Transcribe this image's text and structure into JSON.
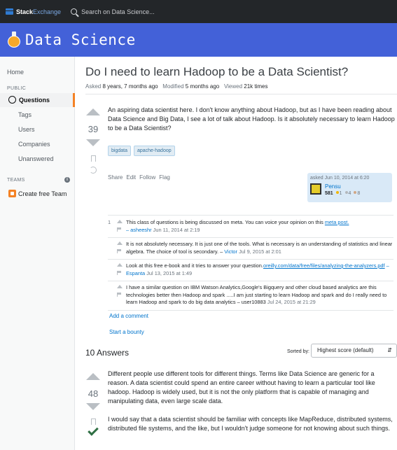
{
  "topbar": {
    "brand_a": "Stack",
    "brand_b": "Exchange",
    "search_placeholder": "Search on Data Science..."
  },
  "site": {
    "name": "Data Science"
  },
  "nav": {
    "home": "Home",
    "public_heading": "PUBLIC",
    "questions": "Questions",
    "tags": "Tags",
    "users": "Users",
    "companies": "Companies",
    "unanswered": "Unanswered",
    "teams_heading": "TEAMS",
    "create_team": "Create free Team"
  },
  "question": {
    "title": "Do I need to learn Hadoop to be a Data Scientist?",
    "asked_label": "Asked",
    "asked_value": "8 years, 7 months ago",
    "modified_label": "Modified",
    "modified_value": "5 months ago",
    "viewed_label": "Viewed",
    "viewed_value": "21k times",
    "score": "39",
    "body": "An aspiring data scientist here. I don't know anything about Hadoop, but as I have been reading about Data Science and Big Data, I see a lot of talk about Hadoop. Is it absolutely necessary to learn Hadoop to be a Data Scientist?",
    "tags": [
      "bigdata",
      "apache-hadoop"
    ],
    "actions": [
      "Share",
      "Edit",
      "Follow",
      "Flag"
    ],
    "owner": {
      "asked": "asked Jun 10, 2014 at 6:20",
      "name": "Pensu",
      "rep": "581",
      "gold": "1",
      "silver": "4",
      "bronze": "8"
    }
  },
  "comments": [
    {
      "num": "1",
      "text": "This class of questions is being discussed on meta. You can voice your opinion on this ",
      "link": "meta post.",
      "user": "– asheeshr",
      "date": "Jun 11, 2014 at 2:19"
    },
    {
      "num": "",
      "text": "It is not absolutely necessary. It is just one of the tools. What is necessary is an understanding of statistics and linear algebra. The choice of tool is secondary. – ",
      "link": "",
      "user": "Victor",
      "date": "Jul 9, 2015 at 2:01"
    },
    {
      "num": "",
      "text": "Look at this free e-book and it tries to answer your question.",
      "link": "oreilly.com/data/free/files/analyzing-the-analyzers.pdf",
      "user": " – Espanta",
      "date": "Jul 13, 2015 at 1:49"
    },
    {
      "num": "",
      "text": "I have a similar question on IBM Watson Analytics,Google's Bigquery and other cloud based analytics are this technologies better then Hadoop and spark .....I am just starting to learn Hadoop and spark and do I really need to learn Hadoop and spark to do big data analytics – user10883",
      "link": "",
      "user": "",
      "date": "Jul 24, 2015 at 21:29"
    }
  ],
  "add_comment": "Add a comment",
  "start_bounty": "Start a bounty",
  "answers": {
    "heading": "10 Answers",
    "sort_label": "Sorted by:",
    "sort_value": "Highest score (default)",
    "first": {
      "score": "48",
      "p1": "Different people use different tools for different things. Terms like Data Science are generic for a reason. A data scientist could spend an entire career without having to learn a particular tool like hadoop. Hadoop is widely used, but it is not the only platform that is capable of managing and manipulating data, even large scale data.",
      "p2": "I would say that a data scientist should be familiar with concepts like MapReduce, distributed systems, distributed file systems, and the like, but I wouldn't judge someone for not knowing about such things."
    }
  },
  "colors": {
    "accent": "#f48225",
    "brand": "#4361d8",
    "link": "#0074cc",
    "accepted": "#2f6f44"
  }
}
